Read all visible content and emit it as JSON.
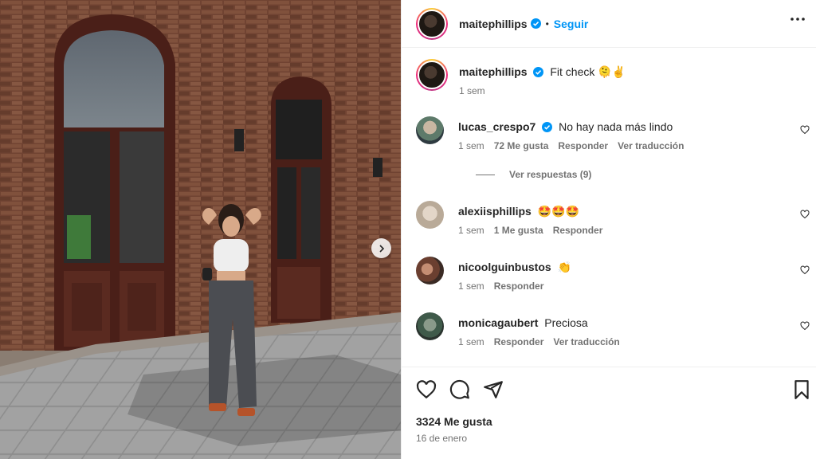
{
  "header": {
    "username": "maitephillips",
    "dot": "•",
    "follow_label": "Seguir"
  },
  "caption": {
    "username": "maitephillips",
    "text": "Fit check 🫠✌️",
    "time": "1 sem"
  },
  "comments": [
    {
      "username": "lucas_crespo7",
      "verified": true,
      "text": "No hay nada más lindo",
      "time": "1 sem",
      "likes": "72 Me gusta",
      "reply": "Responder",
      "translate": "Ver traducción",
      "view_replies": "Ver respuestas (9)"
    },
    {
      "username": "alexiisphillips",
      "text": "🤩🤩🤩",
      "time": "1 sem",
      "likes": "1 Me gusta",
      "reply": "Responder"
    },
    {
      "username": "nicoolguinbustos",
      "text": "👏",
      "time": "1 sem",
      "reply": "Responder"
    },
    {
      "username": "monicagaubert",
      "text": "Preciosa",
      "time": "1 sem",
      "reply": "Responder",
      "translate": "Ver traducción"
    }
  ],
  "footer": {
    "likes": "3324 Me gusta",
    "date": "16 de enero"
  },
  "icons": {
    "verified": "verified-badge-icon",
    "more": "more-options-icon",
    "like": "heart-icon",
    "comment": "comment-icon",
    "share": "share-icon",
    "save": "bookmark-icon",
    "next": "chevron-right-icon"
  },
  "colors": {
    "accent": "#0095f6",
    "muted": "#737373",
    "text": "#262626"
  }
}
